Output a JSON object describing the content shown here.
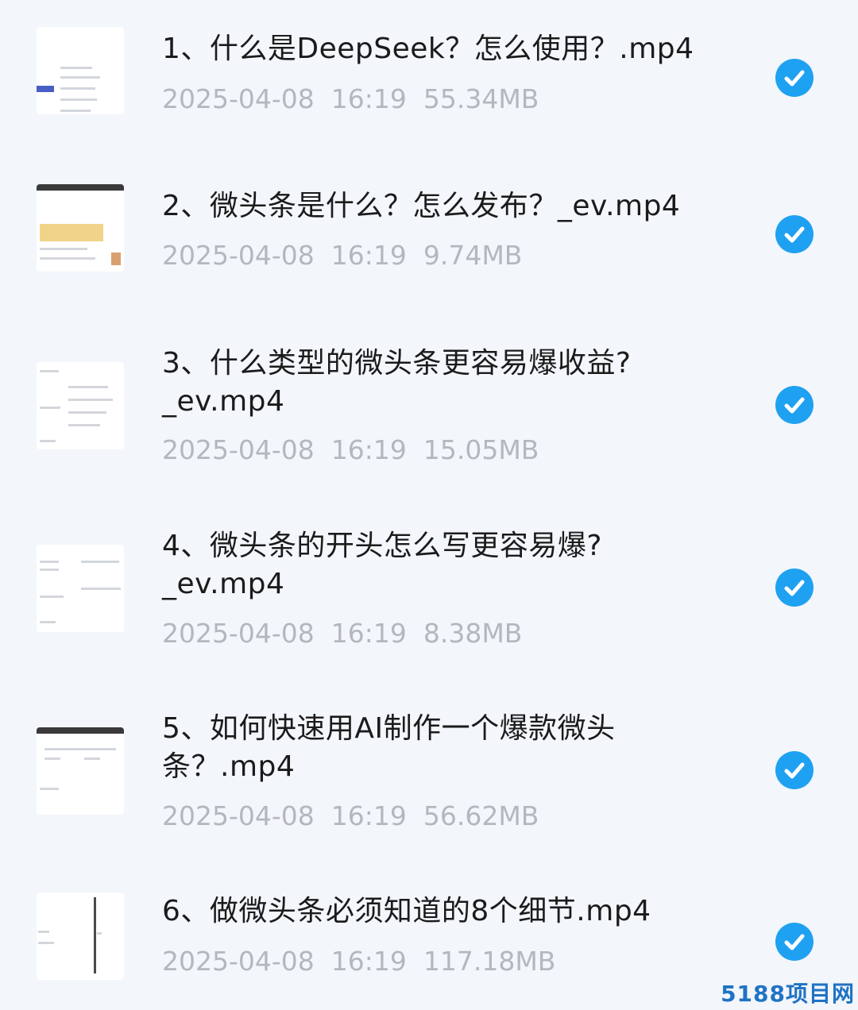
{
  "files": [
    {
      "title": "1、什么是DeepSeek？怎么使用？.mp4",
      "date": "2025-04-08",
      "time": "16:19",
      "size": "55.34MB"
    },
    {
      "title": "2、微头条是什么？怎么发布？_ev.mp4",
      "date": "2025-04-08",
      "time": "16:19",
      "size": "9.74MB"
    },
    {
      "title": "3、什么类型的微头条更容易爆收益?_ev.mp4",
      "date": "2025-04-08",
      "time": "16:19",
      "size": "15.05MB"
    },
    {
      "title": "4、微头条的开头怎么写更容易爆?_ev.mp4",
      "date": "2025-04-08",
      "time": "16:19",
      "size": "8.38MB"
    },
    {
      "title": "5、如何快速用AI制作一个爆款微头条？.mp4",
      "date": "2025-04-08",
      "time": "16:19",
      "size": "56.62MB"
    },
    {
      "title": "6、做微头条必须知道的8个细节.mp4",
      "date": "2025-04-08",
      "time": "16:19",
      "size": "117.18MB"
    }
  ],
  "watermark": "5188项目网",
  "colors": {
    "check": "#1fa1f2",
    "meta": "#b4b7bd",
    "background": "#f3f6fb"
  }
}
